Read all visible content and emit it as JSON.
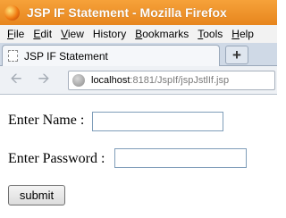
{
  "window": {
    "title": "JSP IF Statement - Mozilla Firefox"
  },
  "menu": [
    {
      "accel": "F",
      "rest": "ile"
    },
    {
      "accel": "E",
      "rest": "dit"
    },
    {
      "accel": "V",
      "rest": "iew"
    },
    {
      "accel": "H",
      "pre": "",
      "rest": "istory"
    },
    {
      "accel": "B",
      "rest": "ookmarks"
    },
    {
      "accel": "T",
      "rest": "ools"
    },
    {
      "accel": "H",
      "rest": "elp"
    }
  ],
  "tab": {
    "label": "JSP IF Statement",
    "new_tab_label": "+"
  },
  "navbar": {
    "back_icon": "back-arrow-icon",
    "forward_icon": "forward-arrow-icon",
    "url_host": "localhost",
    "url_rest": ":8181/JspIf/jspJstlIf.jsp"
  },
  "form": {
    "name_label": "Enter Name :",
    "name_value": "",
    "password_label": "Enter Password :",
    "password_value": "",
    "submit_label": "submit"
  }
}
